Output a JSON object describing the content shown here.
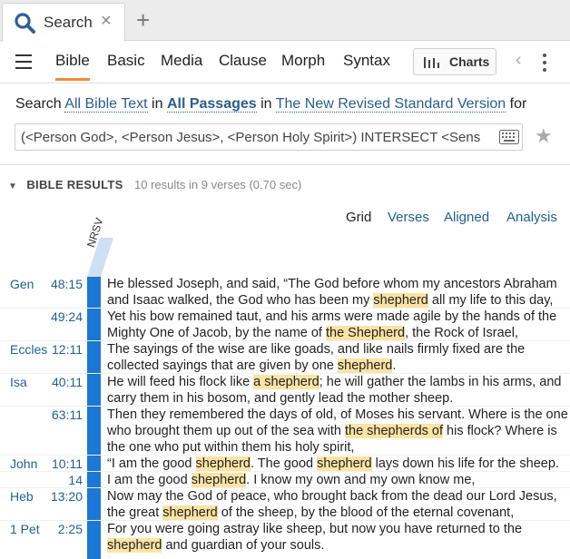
{
  "tabbar": {
    "tab_title": "Search",
    "tab_icon": "search-icon",
    "close_icon": "close-icon",
    "new_tab_icon": "plus-icon"
  },
  "toolbar": {
    "tabs": [
      "Bible",
      "Basic",
      "Media",
      "Clause",
      "Morph",
      "Syntax"
    ],
    "active_tab": "Bible",
    "charts_label": "Charts"
  },
  "search": {
    "prefix": "Search",
    "scope": "All Bible Text",
    "in1": "in",
    "passages": "All Passages",
    "in2": "in",
    "version": "The New Revised Standard Version",
    "suffix": "for",
    "query": "(<Person God>, <Person Jesus>, <Person Holy Spirit>) INTERSECT <Sens"
  },
  "results": {
    "heading": "BIBLE RESULTS",
    "stats": "10 results in 9 verses (0.70 sec)",
    "views": [
      "Grid",
      "Verses",
      "Aligned",
      "Analysis"
    ],
    "active_view": "Grid",
    "version_column": "NRSV",
    "accent_color": "#1c78d6",
    "highlight_color": "#fbe3a3",
    "rows": [
      {
        "book": "Gen",
        "ref": "48:15",
        "lines": [
          [
            {
              "t": "He blessed Joseph, and said, “The God before whom my ancestors Abraham"
            }
          ],
          [
            {
              "t": "and Isaac walked, the God who has been my "
            },
            {
              "t": "shepherd",
              "h": true
            },
            {
              "t": " all my life to this day,"
            }
          ]
        ]
      },
      {
        "book": "",
        "ref": "49:24",
        "lines": [
          [
            {
              "t": "Yet his bow remained taut, and his arms were made agile by the hands of the"
            }
          ],
          [
            {
              "t": "Mighty One of Jacob, by the name of "
            },
            {
              "t": "the Shepherd",
              "h": true
            },
            {
              "t": ", the Rock of Israel,"
            }
          ]
        ]
      },
      {
        "book": "Eccles",
        "ref": "12:11",
        "lines": [
          [
            {
              "t": "The sayings of the wise are like goads, and like nails firmly fixed are the"
            }
          ],
          [
            {
              "t": "collected sayings that are given by one "
            },
            {
              "t": "shepherd",
              "h": true
            },
            {
              "t": "."
            }
          ]
        ]
      },
      {
        "book": "Isa",
        "ref": "40:11",
        "lines": [
          [
            {
              "t": "He will feed his flock like "
            },
            {
              "t": "a shepherd",
              "h": true
            },
            {
              "t": "; he will gather the lambs in his arms, and"
            }
          ],
          [
            {
              "t": "carry them in his bosom, and gently lead the mother sheep."
            }
          ]
        ]
      },
      {
        "book": "",
        "ref": "63:11",
        "lines": [
          [
            {
              "t": "Then they remembered the days of old, of Moses his servant. Where is the one"
            }
          ],
          [
            {
              "t": "who brought them up out of the sea with "
            },
            {
              "t": "the shepherds of",
              "h": true
            },
            {
              "t": " his flock? Where is"
            }
          ],
          [
            {
              "t": "the one who put within them his holy spirit,"
            }
          ]
        ]
      },
      {
        "book": "John",
        "ref": "10:11",
        "lines": [
          [
            {
              "t": "“I am the good "
            },
            {
              "t": "shepherd",
              "h": true
            },
            {
              "t": ". The good "
            },
            {
              "t": "shepherd",
              "h": true
            },
            {
              "t": " lays down his life for the sheep."
            }
          ]
        ]
      },
      {
        "book": "",
        "ref": "14",
        "lines": [
          [
            {
              "t": "I am the good "
            },
            {
              "t": "shepherd",
              "h": true
            },
            {
              "t": ". I know my own and my own know me,"
            }
          ]
        ]
      },
      {
        "book": "Heb",
        "ref": "13:20",
        "lines": [
          [
            {
              "t": "Now may the God of peace, who brought back from the dead our Lord Jesus,"
            }
          ],
          [
            {
              "t": "the great "
            },
            {
              "t": "shepherd",
              "h": true
            },
            {
              "t": " of the sheep, by the blood of the eternal covenant,"
            }
          ]
        ]
      },
      {
        "book": "1 Pet",
        "ref": "2:25",
        "lines": [
          [
            {
              "t": "For you were going astray like sheep, but now you have returned to the"
            }
          ],
          [
            {
              "t": "shepherd",
              "h": true
            },
            {
              "t": " and guardian of your souls."
            }
          ]
        ]
      }
    ]
  }
}
